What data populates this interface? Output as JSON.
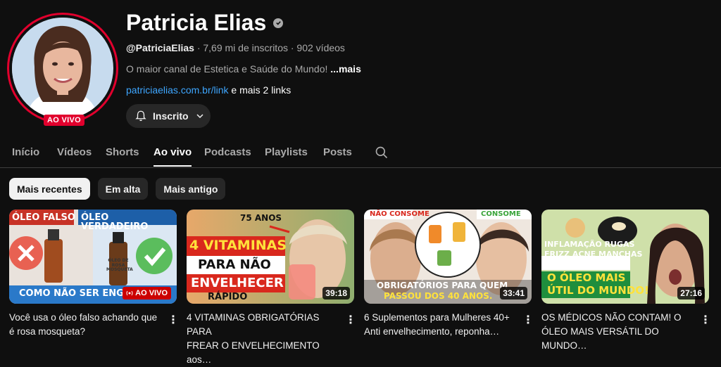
{
  "channel": {
    "name": "Patricia Elias",
    "handle": "@PatriciaElias",
    "stats": " · 7,69 mi de inscritos · 902 vídeos",
    "description": "O maior canal de Estetica e Saúde do Mundo! ",
    "more": "...mais",
    "link": "patriciaelias.com.br/link",
    "links_more": " e mais 2 links",
    "live_label": "AO VIVO",
    "subscribe_label": "Inscrito",
    "accent": "#e1002d"
  },
  "tabs": [
    "Início",
    "Vídeos",
    "Shorts",
    "Ao vivo",
    "Podcasts",
    "Playlists",
    "Posts"
  ],
  "filters": [
    "Mais recentes",
    "Em alta",
    "Mais antigo"
  ],
  "videos": [
    {
      "title_line1": "Você usa o óleo falso achando que",
      "title_line2": "é rosa mosqueta?",
      "badge": "AO VIVO",
      "thumb": {
        "t1": "ÓLEO FALSO",
        "t2": "ÓLEO VERDADEIRO",
        "t3": "ÓLEO DE ROSA MOSQUETA",
        "t4": "COMO NÃO SER ENGANADA"
      }
    },
    {
      "title_line1": "4 VITAMINAS OBRIGATÓRIAS PARA",
      "title_line2": "FREAR O ENVELHECIMENTO aos…",
      "duration": "39:18",
      "thumb": {
        "t1": "75 ANOS",
        "t2": "4 VITAMINAS",
        "t3": "PARA NÃO",
        "t4": "ENVELHECER",
        "t5": "RÁPIDO"
      }
    },
    {
      "title_line1": "6 Suplementos para Mulheres 40+",
      "title_line2": "Anti envelhecimento, reponha…",
      "duration": "33:41",
      "thumb": {
        "t1": "NÃO CONSOME",
        "t2": "CONSOME",
        "t3": "OBRIGATÓRIOS PARA QUEM",
        "t4": "PASSOU DOS 40 ANOS."
      }
    },
    {
      "title_line1": "OS MÉDICOS NÃO CONTAM! O",
      "title_line2": "ÓLEO MAIS VERSÁTIL DO MUNDO…",
      "duration": "27:16",
      "thumb": {
        "t1": "INFLAMAÇÃO RUGAS",
        "t2": "FRIZZ ACNE MANCHAS",
        "t3": "O ÓLEO MAIS",
        "t4": "ÚTIL DO MUNDO!"
      }
    }
  ]
}
